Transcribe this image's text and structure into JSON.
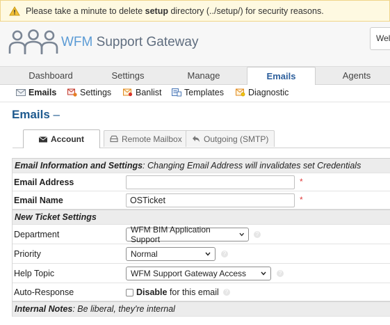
{
  "warning": {
    "prefix": "Please take a minute to delete ",
    "bold": "setup",
    "suffix": " directory (../setup/) for security reasons."
  },
  "header": {
    "logo_brand": "WFM",
    "logo_name": " Support Gateway",
    "welcome_text": "Welcome"
  },
  "main_tabs": [
    "Dashboard",
    "Settings",
    "Manage",
    "Emails",
    "Agents"
  ],
  "sub_nav": [
    "Emails",
    "Settings",
    "Banlist",
    "Templates",
    "Diagnostic"
  ],
  "page": {
    "title": "Emails",
    "dash": " –"
  },
  "form_tabs": [
    "Account",
    "Remote Mailbox",
    "Outgoing (SMTP)"
  ],
  "sections": {
    "email_info": {
      "title": "Email Information and Settings",
      "note": ": Changing Email Address will invalidates set Credentials"
    },
    "new_ticket": {
      "title": "New Ticket Settings"
    },
    "internal_notes": {
      "title": "Internal Notes",
      "note": ": Be liberal, they're internal"
    }
  },
  "fields": {
    "email_address": {
      "label": "Email Address",
      "value": "",
      "required": "*"
    },
    "email_name": {
      "label": "Email Name",
      "value": "OSTicket",
      "required": "*"
    },
    "department": {
      "label": "Department",
      "value": "WFM BIM Application Support"
    },
    "priority": {
      "label": "Priority",
      "value": "Normal"
    },
    "help_topic": {
      "label": "Help Topic",
      "value": "WFM Support Gateway Access"
    },
    "auto_response": {
      "label": "Auto-Response",
      "option_bold": "Disable",
      "option_rest": " for this email"
    }
  },
  "colors": {
    "accent": "#1e5a8f",
    "warning_bg": "#fef9e1",
    "required": "#e03b3b"
  }
}
